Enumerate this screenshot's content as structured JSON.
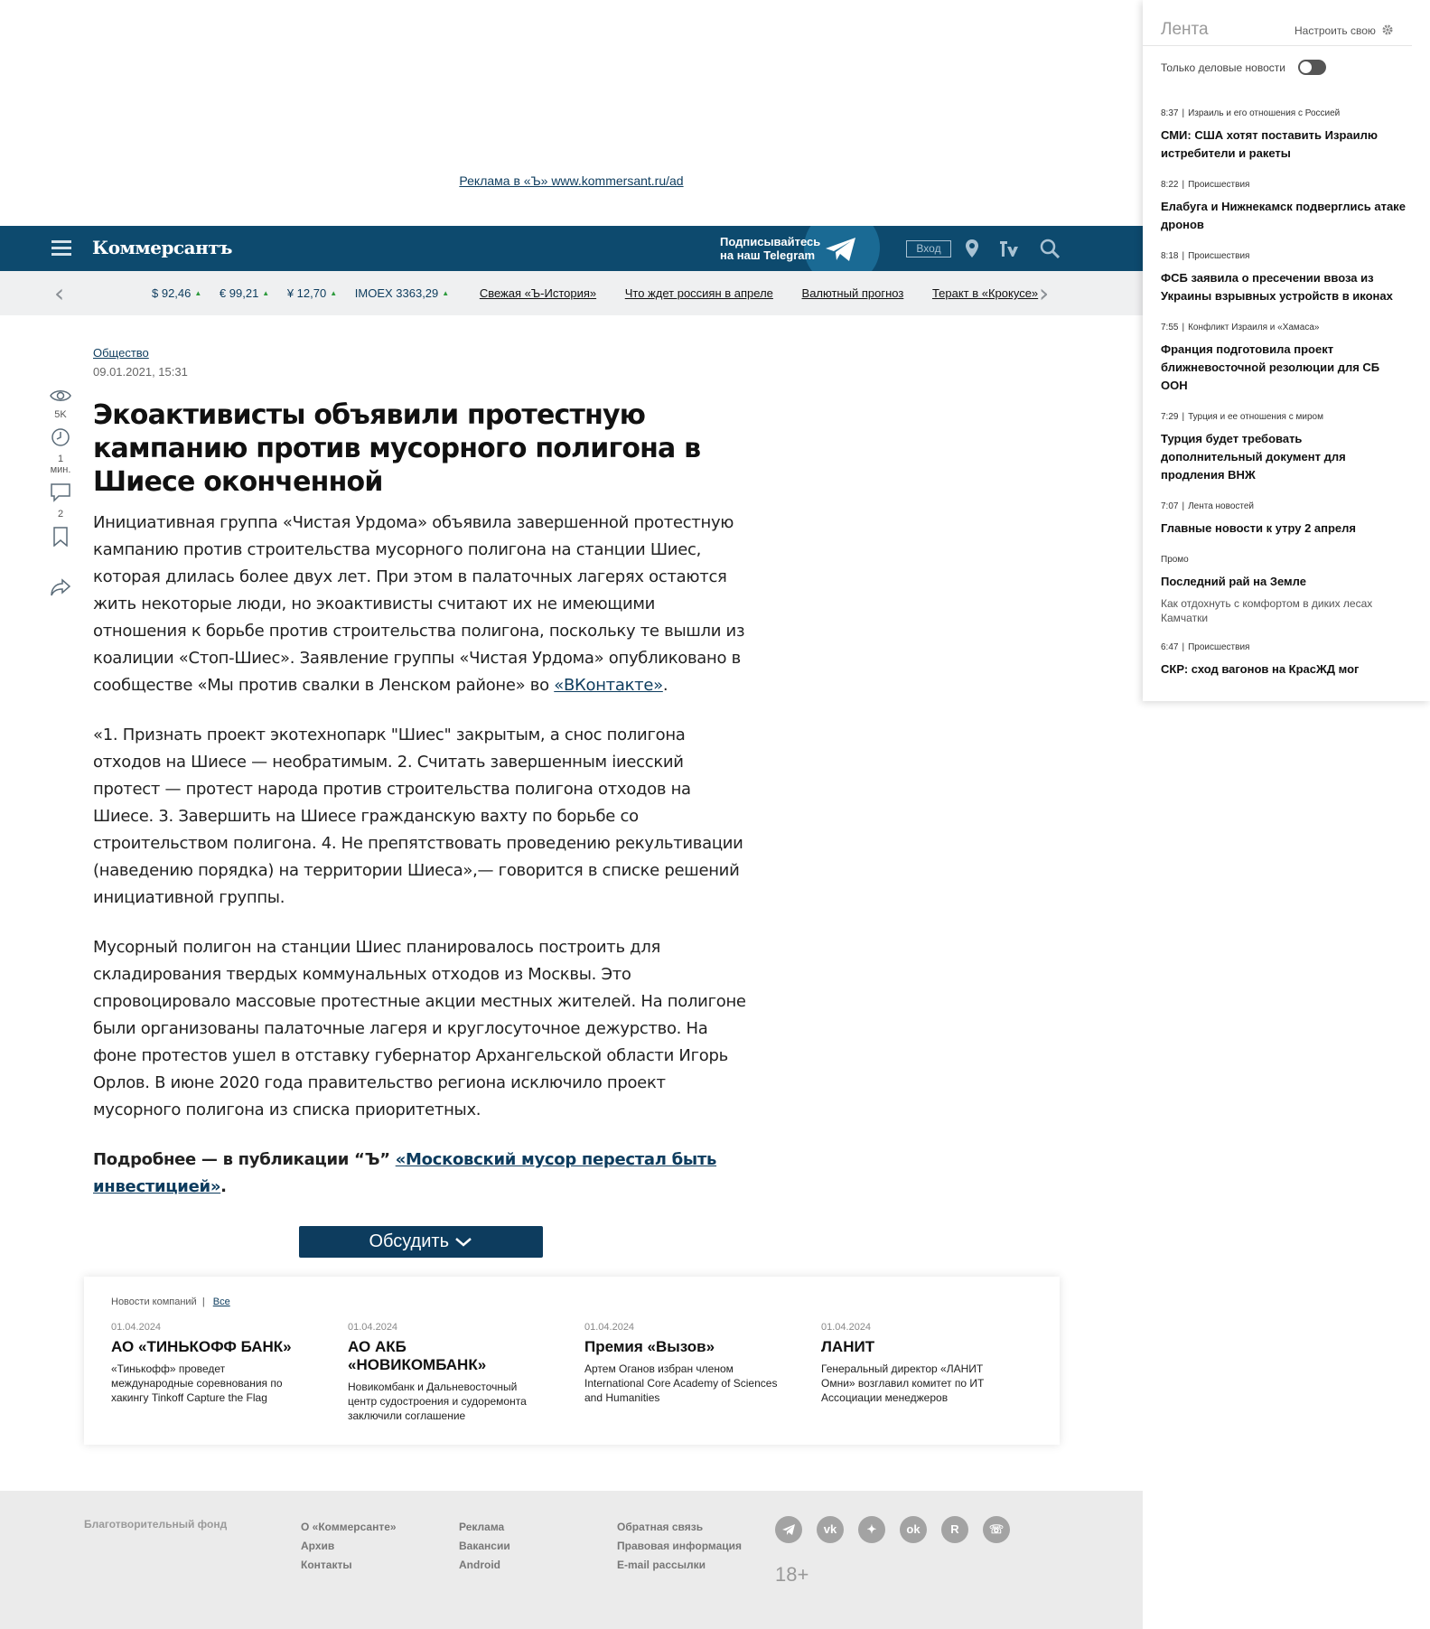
{
  "ad": {
    "link": "Реклама в «Ъ» www.kommersant.ru/ad"
  },
  "header": {
    "logo": "Коммерсантъ",
    "telegram_line1": "Подписывайтесь",
    "telegram_line2": "на наш Telegram",
    "login": "Вход",
    "icons": [
      "menu-icon",
      "location-icon",
      "radio-icon",
      "search-icon"
    ]
  },
  "ticker": {
    "rates": [
      {
        "label": "$ 92,46"
      },
      {
        "label": "€ 99,21"
      },
      {
        "label": "¥ 12,70"
      },
      {
        "label": "IMOEX 3363,29"
      }
    ],
    "links": [
      "Свежая «Ъ-История»",
      "Что ждет россиян в апреле",
      "Валютный прогноз",
      "Теракт в «Крокусе»"
    ]
  },
  "tools": {
    "views": "5K",
    "read_time": "1 мин.",
    "comments": "2"
  },
  "article": {
    "rubric": "Общество",
    "date": "09.01.2021, 15:31",
    "title": "Экоактивисты объявили протестную кампанию против мусорного полигона в Шиесе оконченной",
    "p1_text": "Инициативная группа «Чистая Урдома» объявила завершенной протестную кампанию против строительства мусорного полигона на станции Шиес, которая длилась более двух лет. При этом в палаточных лагерях остаются жить некоторые люди, но экоактивисты считают их не имеющими отношения к борьбе против строительства полигона, поскольку те вышли из коалиции «Стоп-Шиес». Заявление группы «Чистая Урдома» опубликовано в сообществе «Мы против свалки в Ленском районе» во ",
    "p1_link": "«ВКонтакте»",
    "p1_end": ".",
    "p2": "«1. Признать проект экотехнопарк \"Шиес\" закрытым, а снос полигона отходов на Шиесе — необратимым. 2. Считать завершенным іиесский протест — протест народа против строительства полигона отходов на Шиесе. 3. Завершить на Шиесе гражданскую вахту по борьбе со строительством полигона. 4. Не препятствовать проведению рекультивации (наведению порядка) на территории Шиеса»,— говорится в списке решений инициативной группы.",
    "p3": "Мусорный полигон на станции Шиес планировалось построить для складирования твердых коммунальных отходов из Москвы. Это спровоцировало массовые протестные акции местных жителей. На полигоне были организованы палаточные лагеря и круглосуточное дежурство. На фоне протестов ушел в отставку губернатор Архангельской области Игорь Орлов. В июне 2020 года правительство региона исключило проект мусорного полигона из списка приоритетных.",
    "more_prefix": "Подробнее — в публикации “Ъ” ",
    "more_link": "«Московский мусор перестал быть инвестицией»",
    "more_end": ".",
    "discuss": "Обсудить"
  },
  "company_news": {
    "title": "Новости компаний",
    "all": "Все",
    "items": [
      {
        "date": "01.04.2024",
        "company": "АО «ТИНЬКОФФ БАНК»",
        "text": "«Тинькофф» проведет международные соревнования по хакингу Tinkoff Capture the Flag"
      },
      {
        "date": "01.04.2024",
        "company": "АО АКБ «НОВИКОМБАНК»",
        "text": "Новикомбанк и Дальневосточный центр судостроения и судоремонта заключили соглашение"
      },
      {
        "date": "01.04.2024",
        "company": "Премия «Вызов»",
        "text": "Артем Оганов избран членом International Core Academy of Sciences and Humanities"
      },
      {
        "date": "01.04.2024",
        "company": "ЛАНИТ",
        "text": "Генеральный директор «ЛАНИТ Омни» возглавил комитет по ИТ Ассоциации менеджеров"
      }
    ]
  },
  "footer": {
    "fund": "Благотворительный фонд",
    "col1": [
      "О «Коммерсанте»",
      "Архив",
      "Контакты"
    ],
    "col2": [
      "Реклама",
      "Вакансии",
      "Android"
    ],
    "col3": [
      "Обратная связь",
      "Правовая информация",
      "E-mail рассылки"
    ],
    "social": [
      "telegram-icon",
      "vk-icon",
      "dzen-icon",
      "ok-icon",
      "rutube-icon",
      "viber-icon"
    ],
    "age": "18+"
  },
  "feed": {
    "title": "Лента",
    "settings": "Настроить свою",
    "toggle_label": "Только деловые новости",
    "items": [
      {
        "time": "8:37",
        "rubric": "Израиль и его отношения с Россией",
        "headline": "СМИ: США хотят поставить Израилю истребители и ракеты"
      },
      {
        "time": "8:22",
        "rubric": "Происшествия",
        "headline": "Елабуга и Нижнекамск подверглись атаке дронов"
      },
      {
        "time": "8:18",
        "rubric": "Происшествия",
        "headline": "ФСБ заявила о пресечении ввоза из Украины взрывных устройств в иконах"
      },
      {
        "time": "7:55",
        "rubric": "Конфликт Израиля и «Хамаса»",
        "headline": "Франция подготовила проект ближневосточной резолюции для СБ ООН"
      },
      {
        "time": "7:29",
        "rubric": "Турция и ее отношения с миром",
        "headline": "Турция будет требовать дополнительный документ для продления ВНЖ"
      },
      {
        "time": "7:07",
        "rubric": "Лента новостей",
        "headline": "Главные новости к утру 2 апреля"
      }
    ],
    "promo": {
      "label": "Промо",
      "headline": "Последний рай на Земле",
      "sub": "Как отдохнуть с комфортом в диких лесах Камчатки"
    },
    "last": {
      "time": "6:47",
      "rubric": "Происшествия",
      "headline": "СКР: сход вагонов на КрасЖД мог"
    }
  }
}
